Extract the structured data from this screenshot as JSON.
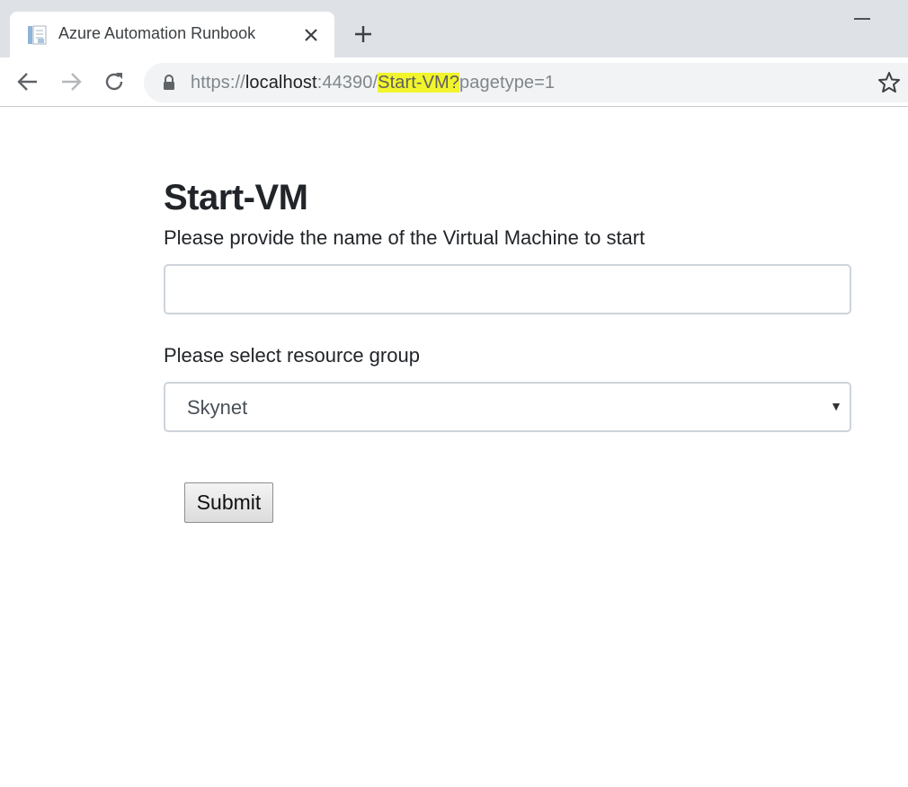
{
  "browser": {
    "tab": {
      "title": "Azure Automation Runbook",
      "favicon": "document-icon"
    },
    "url": {
      "scheme": "https://",
      "host": "localhost",
      "port": ":44390/",
      "path": "Start-VM?",
      "query": "pagetype=1",
      "highlight_color": "#f2f52b"
    },
    "icons": [
      "close-icon",
      "plus-icon",
      "minimize-icon",
      "back-arrow-icon",
      "forward-arrow-icon",
      "reload-icon",
      "lock-icon",
      "star-icon"
    ]
  },
  "page": {
    "title": "Start-VM",
    "vm_label": "Please provide the name of the Virtual Machine to start",
    "vm_value": "",
    "rg_label": "Please select resource group",
    "rg_selected": "Skynet",
    "submit_label": "Submit"
  }
}
